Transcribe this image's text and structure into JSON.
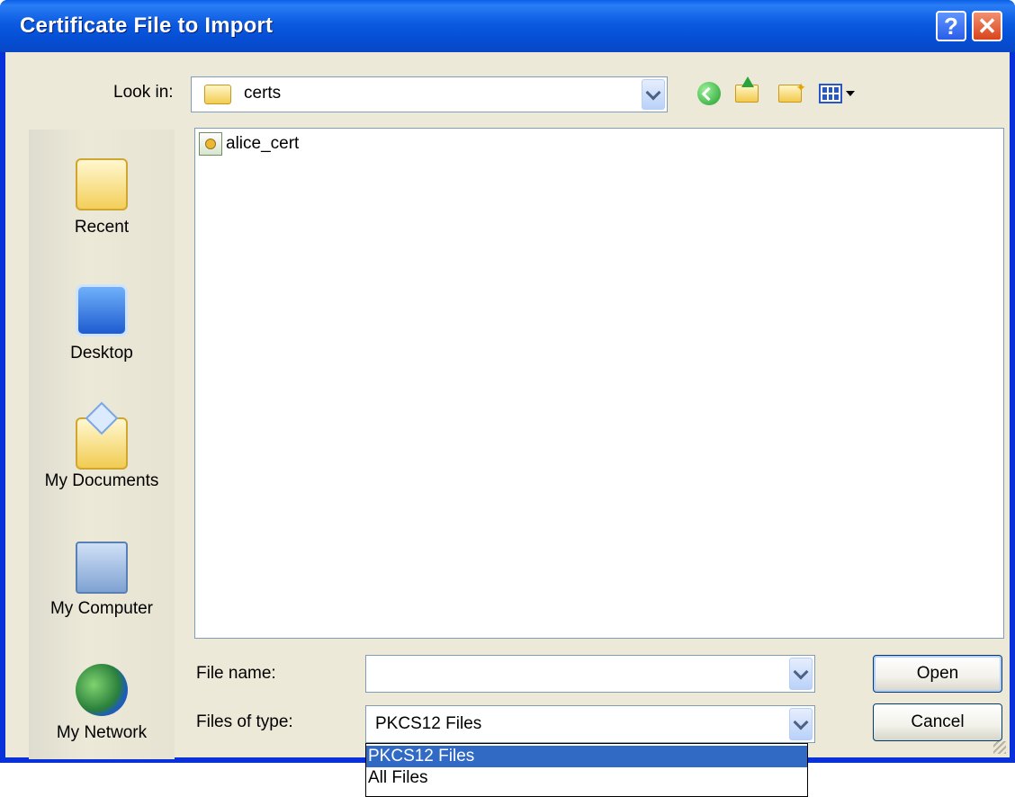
{
  "window": {
    "title": "Certificate File to Import",
    "help_button": "?",
    "close_button": "✕"
  },
  "look_in": {
    "label": "Look in:",
    "value": "certs"
  },
  "toolbar": {
    "icons": [
      "back-icon",
      "up-folder-icon",
      "new-folder-icon",
      "views-menu-icon"
    ]
  },
  "places": [
    {
      "label": "Recent",
      "icon": "recent-folder-icon"
    },
    {
      "label": "Desktop",
      "icon": "desktop-icon"
    },
    {
      "label": "My Documents",
      "icon": "my-documents-icon"
    },
    {
      "label": "My Computer",
      "icon": "my-computer-icon"
    },
    {
      "label": "My Network",
      "icon": "my-network-icon"
    }
  ],
  "files": [
    {
      "name": "alice_cert",
      "icon": "certificate-file-icon"
    }
  ],
  "file_name": {
    "label": "File name:",
    "value": ""
  },
  "file_type": {
    "label": "Files of type:",
    "value": "PKCS12 Files",
    "options": [
      "PKCS12 Files",
      "All Files"
    ]
  },
  "buttons": {
    "open": "Open",
    "cancel": "Cancel"
  },
  "colors": {
    "title_bar": "#0a5fe8",
    "dialog_bg": "#ece9d8",
    "selection": "#316ac5"
  }
}
